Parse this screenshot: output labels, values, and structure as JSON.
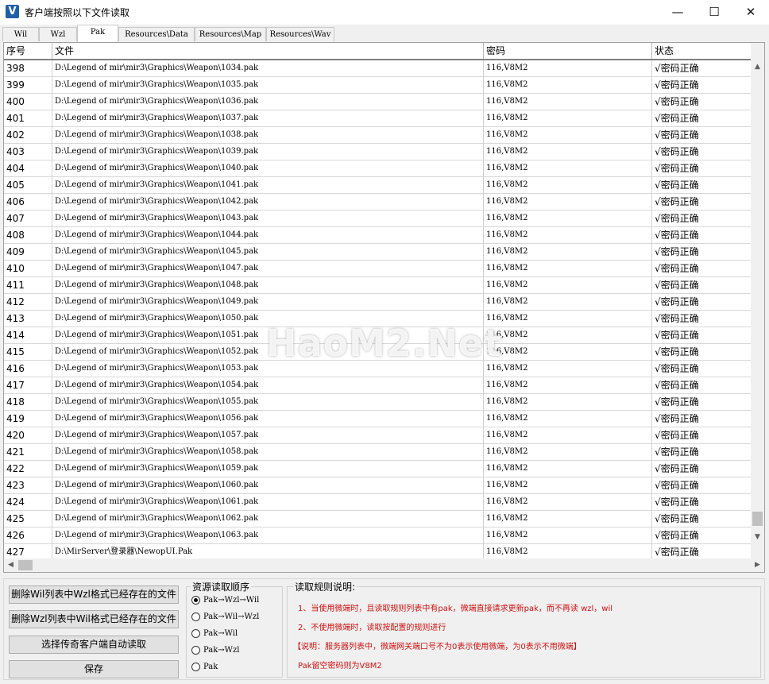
{
  "window": {
    "title": "客户端按照以下文件读取",
    "icon_letter": "V",
    "minimize": "—",
    "maximize": "☐",
    "close": "✕"
  },
  "tabs": [
    "Wil",
    "Wzl",
    "Pak",
    "Resources\\Data",
    "Resources\\Map",
    "Resources\\Wav"
  ],
  "active_tab": "Pak",
  "table": {
    "columns": [
      "序号",
      "文件",
      "密码",
      "状态"
    ],
    "rows": [
      {
        "id": "398",
        "file": "D:\\Legend of mir\\mir3\\Graphics\\Weapon\\1034.pak",
        "password": "116,V8M2",
        "status": "√密码正确"
      },
      {
        "id": "399",
        "file": "D:\\Legend of mir\\mir3\\Graphics\\Weapon\\1035.pak",
        "password": "116,V8M2",
        "status": "√密码正确"
      },
      {
        "id": "400",
        "file": "D:\\Legend of mir\\mir3\\Graphics\\Weapon\\1036.pak",
        "password": "116,V8M2",
        "status": "√密码正确"
      },
      {
        "id": "401",
        "file": "D:\\Legend of mir\\mir3\\Graphics\\Weapon\\1037.pak",
        "password": "116,V8M2",
        "status": "√密码正确"
      },
      {
        "id": "402",
        "file": "D:\\Legend of mir\\mir3\\Graphics\\Weapon\\1038.pak",
        "password": "116,V8M2",
        "status": "√密码正确"
      },
      {
        "id": "403",
        "file": "D:\\Legend of mir\\mir3\\Graphics\\Weapon\\1039.pak",
        "password": "116,V8M2",
        "status": "√密码正确"
      },
      {
        "id": "404",
        "file": "D:\\Legend of mir\\mir3\\Graphics\\Weapon\\1040.pak",
        "password": "116,V8M2",
        "status": "√密码正确"
      },
      {
        "id": "405",
        "file": "D:\\Legend of mir\\mir3\\Graphics\\Weapon\\1041.pak",
        "password": "116,V8M2",
        "status": "√密码正确"
      },
      {
        "id": "406",
        "file": "D:\\Legend of mir\\mir3\\Graphics\\Weapon\\1042.pak",
        "password": "116,V8M2",
        "status": "√密码正确"
      },
      {
        "id": "407",
        "file": "D:\\Legend of mir\\mir3\\Graphics\\Weapon\\1043.pak",
        "password": "116,V8M2",
        "status": "√密码正确"
      },
      {
        "id": "408",
        "file": "D:\\Legend of mir\\mir3\\Graphics\\Weapon\\1044.pak",
        "password": "116,V8M2",
        "status": "√密码正确"
      },
      {
        "id": "409",
        "file": "D:\\Legend of mir\\mir3\\Graphics\\Weapon\\1045.pak",
        "password": "116,V8M2",
        "status": "√密码正确"
      },
      {
        "id": "410",
        "file": "D:\\Legend of mir\\mir3\\Graphics\\Weapon\\1047.pak",
        "password": "116,V8M2",
        "status": "√密码正确"
      },
      {
        "id": "411",
        "file": "D:\\Legend of mir\\mir3\\Graphics\\Weapon\\1048.pak",
        "password": "116,V8M2",
        "status": "√密码正确"
      },
      {
        "id": "412",
        "file": "D:\\Legend of mir\\mir3\\Graphics\\Weapon\\1049.pak",
        "password": "116,V8M2",
        "status": "√密码正确"
      },
      {
        "id": "413",
        "file": "D:\\Legend of mir\\mir3\\Graphics\\Weapon\\1050.pak",
        "password": "116,V8M2",
        "status": "√密码正确"
      },
      {
        "id": "414",
        "file": "D:\\Legend of mir\\mir3\\Graphics\\Weapon\\1051.pak",
        "password": "116,V8M2",
        "status": "√密码正确"
      },
      {
        "id": "415",
        "file": "D:\\Legend of mir\\mir3\\Graphics\\Weapon\\1052.pak",
        "password": "116,V8M2",
        "status": "√密码正确"
      },
      {
        "id": "416",
        "file": "D:\\Legend of mir\\mir3\\Graphics\\Weapon\\1053.pak",
        "password": "116,V8M2",
        "status": "√密码正确"
      },
      {
        "id": "417",
        "file": "D:\\Legend of mir\\mir3\\Graphics\\Weapon\\1054.pak",
        "password": "116,V8M2",
        "status": "√密码正确"
      },
      {
        "id": "418",
        "file": "D:\\Legend of mir\\mir3\\Graphics\\Weapon\\1055.pak",
        "password": "116,V8M2",
        "status": "√密码正确"
      },
      {
        "id": "419",
        "file": "D:\\Legend of mir\\mir3\\Graphics\\Weapon\\1056.pak",
        "password": "116,V8M2",
        "status": "√密码正确"
      },
      {
        "id": "420",
        "file": "D:\\Legend of mir\\mir3\\Graphics\\Weapon\\1057.pak",
        "password": "116,V8M2",
        "status": "√密码正确"
      },
      {
        "id": "421",
        "file": "D:\\Legend of mir\\mir3\\Graphics\\Weapon\\1058.pak",
        "password": "116,V8M2",
        "status": "√密码正确"
      },
      {
        "id": "422",
        "file": "D:\\Legend of mir\\mir3\\Graphics\\Weapon\\1059.pak",
        "password": "116,V8M2",
        "status": "√密码正确"
      },
      {
        "id": "423",
        "file": "D:\\Legend of mir\\mir3\\Graphics\\Weapon\\1060.pak",
        "password": "116,V8M2",
        "status": "√密码正确"
      },
      {
        "id": "424",
        "file": "D:\\Legend of mir\\mir3\\Graphics\\Weapon\\1061.pak",
        "password": "116,V8M2",
        "status": "√密码正确"
      },
      {
        "id": "425",
        "file": "D:\\Legend of mir\\mir3\\Graphics\\Weapon\\1062.pak",
        "password": "116,V8M2",
        "status": "√密码正确"
      },
      {
        "id": "426",
        "file": "D:\\Legend of mir\\mir3\\Graphics\\Weapon\\1063.pak",
        "password": "116,V8M2",
        "status": "√密码正确"
      },
      {
        "id": "427",
        "file": "D:\\MirServer\\登录器\\NewopUI.Pak",
        "password": "116,V8M2",
        "status": "√密码正确"
      }
    ]
  },
  "buttons": {
    "delete_wil_in_wzl": "删除Wil列表中Wzl格式已经存在的文件",
    "delete_wzl_in_wil": "删除Wzl列表中Wil格式已经存在的文件",
    "auto_read": "选择传奇客户端自动读取",
    "save": "保存"
  },
  "order_group": {
    "title": "资源读取顺序",
    "options": [
      "Pak→Wzl→Wil",
      "Pak→Wil→Wzl",
      "Pak→Wil",
      "Pak→Wzl",
      "Pak"
    ],
    "selected_index": 0
  },
  "rules": {
    "title": "读取规则说明:",
    "lines": [
      "1、当使用微端时，且读取规则列表中有pak，微端直接请求更新pak，而不再读 wzl，wil",
      "2、不使用微端时，读取按配置的规则进行",
      "【说明：服务器列表中，微端网关端口号不为0表示使用微端，为0表示不用微端】",
      "Pak留空密码则为V8M2"
    ],
    "color": "#d01010"
  },
  "watermark": "HaoM2.Net"
}
